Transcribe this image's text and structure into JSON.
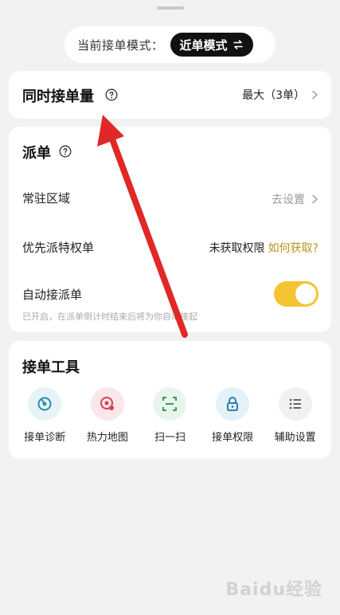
{
  "mode": {
    "label": "当前接单模式：",
    "value": "近单模式"
  },
  "simultaneous": {
    "title": "同时接单量",
    "value": "最大（3单）"
  },
  "dispatch": {
    "title": "派单",
    "rows": [
      {
        "label": "常驻区域",
        "value": "去设置"
      },
      {
        "label": "优先派特权单",
        "value": "未获取权限",
        "link": "如何获取?"
      },
      {
        "label": "自动接派单",
        "hint": "已开启，在派单倒计时结束后将为你自动接起"
      }
    ]
  },
  "tools": {
    "title": "接单工具",
    "items": [
      {
        "label": "接单诊断",
        "icon": "diagnosis-icon"
      },
      {
        "label": "热力地图",
        "icon": "heatmap-icon"
      },
      {
        "label": "扫一扫",
        "icon": "scan-icon"
      },
      {
        "label": "接单权限",
        "icon": "lock-icon"
      },
      {
        "label": "辅助设置",
        "icon": "list-settings-icon"
      }
    ]
  },
  "colors": {
    "accent": "#f4c531",
    "annotation": "#e02828",
    "link": "#b89620"
  },
  "watermark": "Baidu经验"
}
